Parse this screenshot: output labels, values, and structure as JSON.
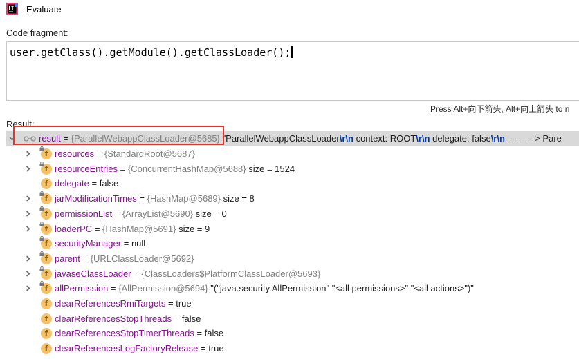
{
  "window": {
    "title": "Evaluate"
  },
  "code_fragment": {
    "label": "Code fragment:",
    "value": "user.getClass().getModule().getClassLoader();"
  },
  "hint": "Press Alt+向下箭头, Alt+向上箭头 to n",
  "result": {
    "label": "Result:",
    "root": {
      "name": "result",
      "eq": " = ",
      "ref": "{ParallelWebappClassLoader@5685}",
      "value_parts": [
        {
          "t": " \"ParallelWebappClassLoader",
          "esc": false
        },
        {
          "t": "\\r\\n",
          "esc": true
        },
        {
          "t": "  context: ROOT",
          "esc": false
        },
        {
          "t": "\\r\\n",
          "esc": true
        },
        {
          "t": "  delegate: false",
          "esc": false
        },
        {
          "t": "\\r\\n",
          "esc": true
        },
        {
          "t": "----------> Pare",
          "esc": false
        }
      ]
    },
    "fields": [
      {
        "name": "resources",
        "ref": "{StandardRoot@5687}",
        "value": "",
        "expandable": true,
        "lock": true
      },
      {
        "name": "resourceEntries",
        "ref": "{ConcurrentHashMap@5688}",
        "value": " size = 1524",
        "expandable": true,
        "lock": true
      },
      {
        "name": "delegate",
        "ref": "",
        "value": "false",
        "expandable": false,
        "lock": false
      },
      {
        "name": "jarModificationTimes",
        "ref": "{HashMap@5689}",
        "value": " size = 8",
        "expandable": true,
        "lock": true
      },
      {
        "name": "permissionList",
        "ref": "{ArrayList@5690}",
        "value": " size = 0",
        "expandable": true,
        "lock": true
      },
      {
        "name": "loaderPC",
        "ref": "{HashMap@5691}",
        "value": " size = 9",
        "expandable": true,
        "lock": true
      },
      {
        "name": "securityManager",
        "ref": "",
        "value": "null",
        "expandable": false,
        "lock": true
      },
      {
        "name": "parent",
        "ref": "{URLClassLoader@5692}",
        "value": "",
        "expandable": true,
        "lock": true
      },
      {
        "name": "javaseClassLoader",
        "ref": "{ClassLoaders$PlatformClassLoader@5693}",
        "value": "",
        "expandable": true,
        "lock": true
      },
      {
        "name": "allPermission",
        "ref": "{AllPermission@5694}",
        "value": " \"(\"java.security.AllPermission\" \"<all permissions>\" \"<all actions>\")\"",
        "expandable": true,
        "lock": true
      },
      {
        "name": "clearReferencesRmiTargets",
        "ref": "",
        "value": "true",
        "expandable": false,
        "lock": false
      },
      {
        "name": "clearReferencesStopThreads",
        "ref": "",
        "value": "false",
        "expandable": false,
        "lock": false
      },
      {
        "name": "clearReferencesStopTimerThreads",
        "ref": "",
        "value": "false",
        "expandable": false,
        "lock": false
      },
      {
        "name": "clearReferencesLogFactoryRelease",
        "ref": "",
        "value": "true",
        "expandable": false,
        "lock": false
      }
    ]
  },
  "colors": {
    "field_name": "#871094",
    "reference": "#808080",
    "escape": "#0037a6",
    "badge": "#f5c26b",
    "selection": "#d9d9d9",
    "annotation_box": "#e8302c"
  },
  "icons": {
    "app": "intellij-idea-icon",
    "field": "field-f-icon",
    "watch": "glasses-icon",
    "expand": "chevron-right-icon",
    "collapse": "chevron-down-icon"
  }
}
